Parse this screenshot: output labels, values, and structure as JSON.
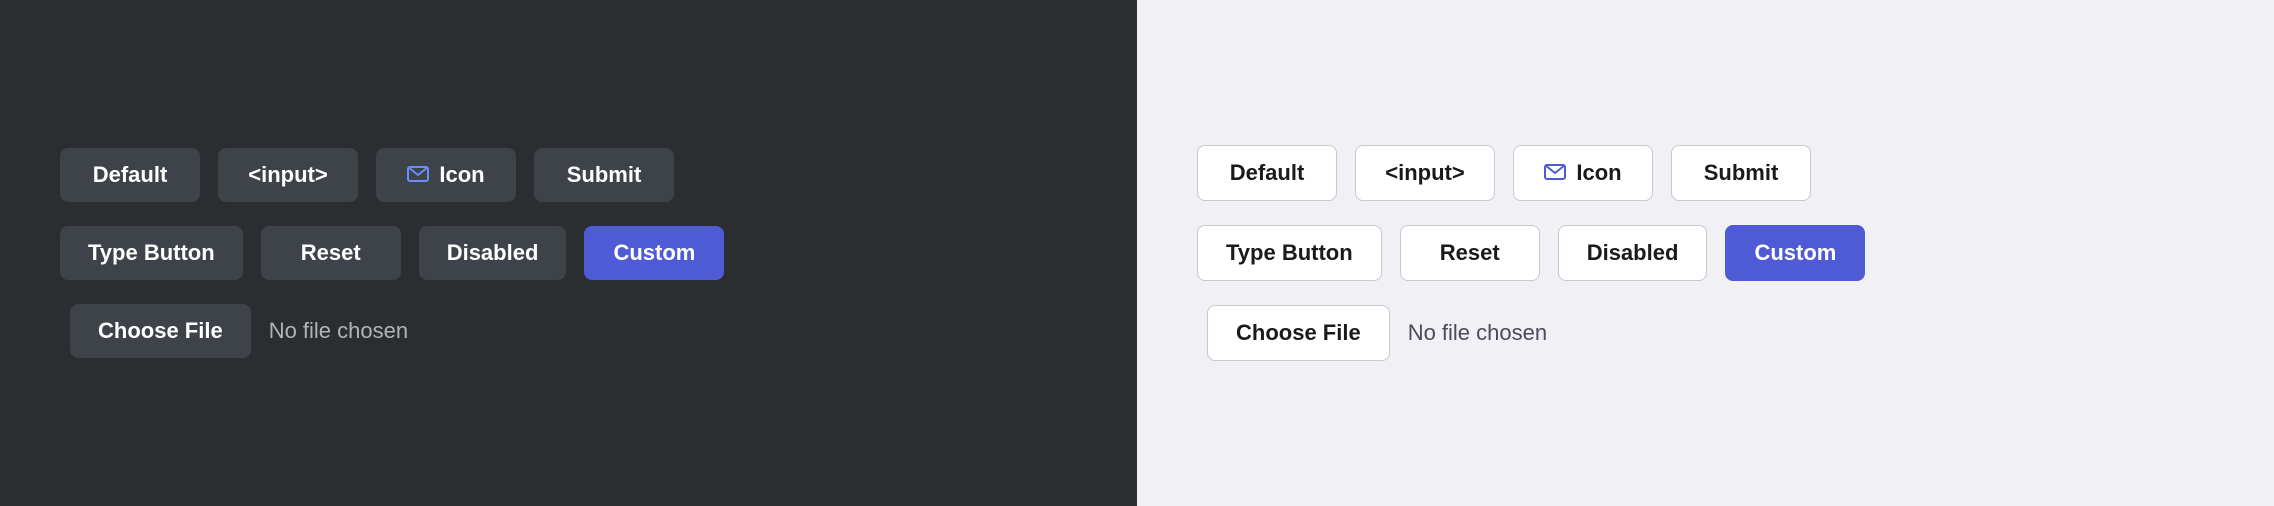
{
  "dark_panel": {
    "row1": {
      "default_label": "Default",
      "input_label": "<input>",
      "icon_label": "Icon",
      "submit_label": "Submit"
    },
    "row2": {
      "type_button_label": "Type Button",
      "reset_label": "Reset",
      "disabled_label": "Disabled",
      "custom_label": "Custom"
    },
    "file_row": {
      "choose_label": "Choose File",
      "no_file_label": "No file chosen"
    }
  },
  "light_panel": {
    "row1": {
      "default_label": "Default",
      "input_label": "<input>",
      "icon_label": "Icon",
      "submit_label": "Submit"
    },
    "row2": {
      "type_button_label": "Type Button",
      "reset_label": "Reset",
      "disabled_label": "Disabled",
      "custom_label": "Custom"
    },
    "file_row": {
      "choose_label": "Choose File",
      "no_file_label": "No file chosen"
    }
  }
}
